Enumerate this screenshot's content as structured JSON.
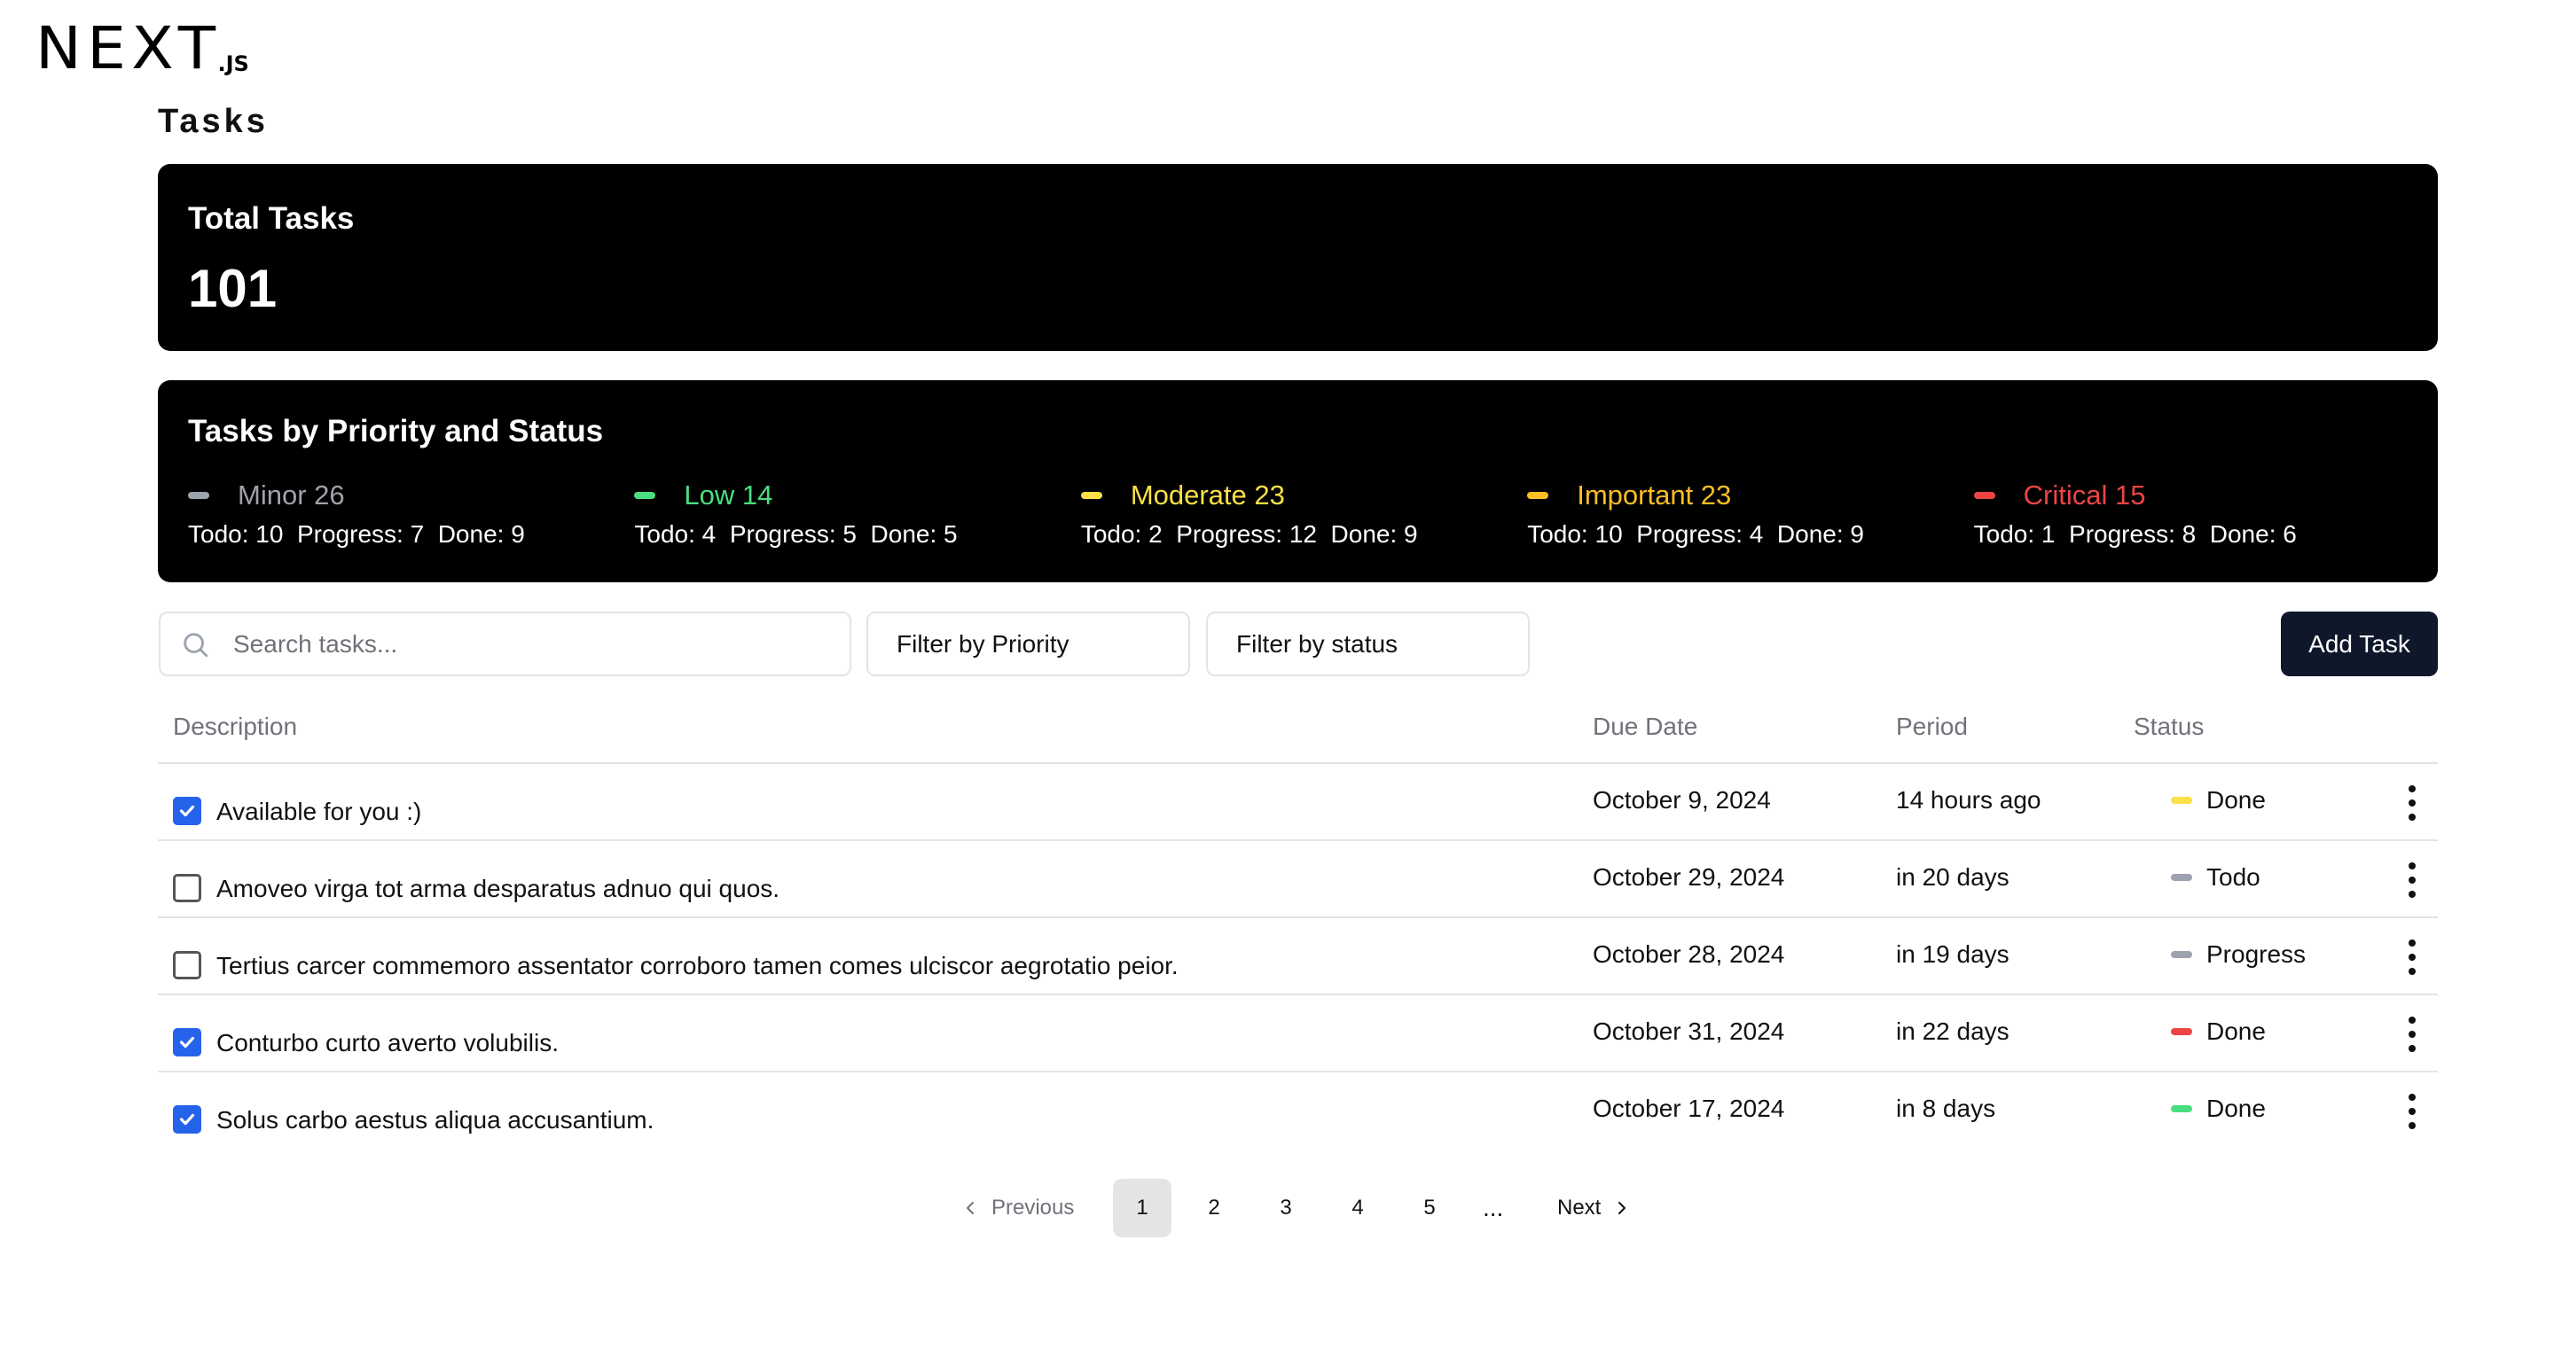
{
  "logo": {
    "main": "NEXT",
    "sub": ".JS"
  },
  "page_title": "Tasks",
  "total_card": {
    "title": "Total Tasks",
    "value": "101"
  },
  "priority_card": {
    "title": "Tasks by Priority and Status",
    "items": [
      {
        "label": "Minor 26",
        "color": "#9ca3af",
        "stats": "Todo: 10  Progress: 7  Done: 9"
      },
      {
        "label": "Low 14",
        "color": "#4ade80",
        "stats": "Todo: 4  Progress: 5  Done: 5"
      },
      {
        "label": "Moderate 23",
        "color": "#fde047",
        "stats": "Todo: 2  Progress: 12  Done: 9"
      },
      {
        "label": "Important 23",
        "color": "#fbbf24",
        "stats": "Todo: 10  Progress: 4  Done: 9"
      },
      {
        "label": "Critical 15",
        "color": "#ef4444",
        "stats": "Todo: 1  Progress: 8  Done: 6"
      }
    ]
  },
  "toolbar": {
    "search_placeholder": "Search tasks...",
    "filter_priority": "Filter by Priority",
    "filter_status": "Filter by status",
    "add_task": "Add Task"
  },
  "table": {
    "headers": {
      "description": "Description",
      "due": "Due Date",
      "period": "Period",
      "status": "Status"
    },
    "rows": [
      {
        "checked": true,
        "description": "Available for you :)",
        "due": "October 9, 2024",
        "period": "14 hours ago",
        "status": "Done",
        "priority_color": "#fde047"
      },
      {
        "checked": false,
        "description": "Amoveo virga tot arma desparatus adnuo qui quos.",
        "due": "October 29, 2024",
        "period": "in 20 days",
        "status": "Todo",
        "priority_color": "#9ca3af"
      },
      {
        "checked": false,
        "description": "Tertius carcer commemoro assentator corroboro tamen comes ulciscor aegrotatio peior.",
        "due": "October 28, 2024",
        "period": "in 19 days",
        "status": "Progress",
        "priority_color": "#9ca3af"
      },
      {
        "checked": true,
        "description": "Conturbo curto averto volubilis.",
        "due": "October 31, 2024",
        "period": "in 22 days",
        "status": "Done",
        "priority_color": "#ef4444"
      },
      {
        "checked": true,
        "description": "Solus carbo aestus aliqua accusantium.",
        "due": "October 17, 2024",
        "period": "in 8 days",
        "status": "Done",
        "priority_color": "#4ade80"
      }
    ]
  },
  "pagination": {
    "previous": "Previous",
    "next": "Next",
    "pages": [
      "1",
      "2",
      "3",
      "4",
      "5"
    ],
    "current": "1",
    "ellipsis": "..."
  }
}
